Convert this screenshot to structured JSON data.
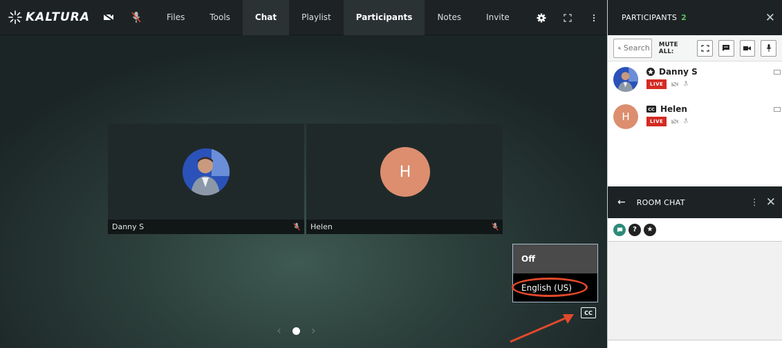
{
  "app": {
    "brand": "KALTURA"
  },
  "nav": [
    "Files",
    "Tools",
    "Chat",
    "Playlist",
    "Participants",
    "Notes",
    "Invite"
  ],
  "stage": {
    "tiles": [
      {
        "name": "Danny S"
      },
      {
        "name": "Helen",
        "initial": "H"
      }
    ]
  },
  "captions": {
    "off": "Off",
    "english": "English (US)",
    "cc_label": "CC"
  },
  "participants_panel": {
    "title": "PARTICIPANTS",
    "count": "2",
    "search_placeholder": "Search",
    "mute_all": "MUTE ALL:",
    "list": [
      {
        "name": "Danny S",
        "live": "LIVE"
      },
      {
        "name": "Helen",
        "initial": "H",
        "live": "LIVE"
      }
    ]
  },
  "chat": {
    "title": "ROOM CHAT"
  },
  "colors": {
    "topbar": "#1d2325",
    "live": "#d32b23",
    "avatar": "#dc8e6f",
    "highlight": "#e2492b",
    "count": "#5cc45e"
  }
}
